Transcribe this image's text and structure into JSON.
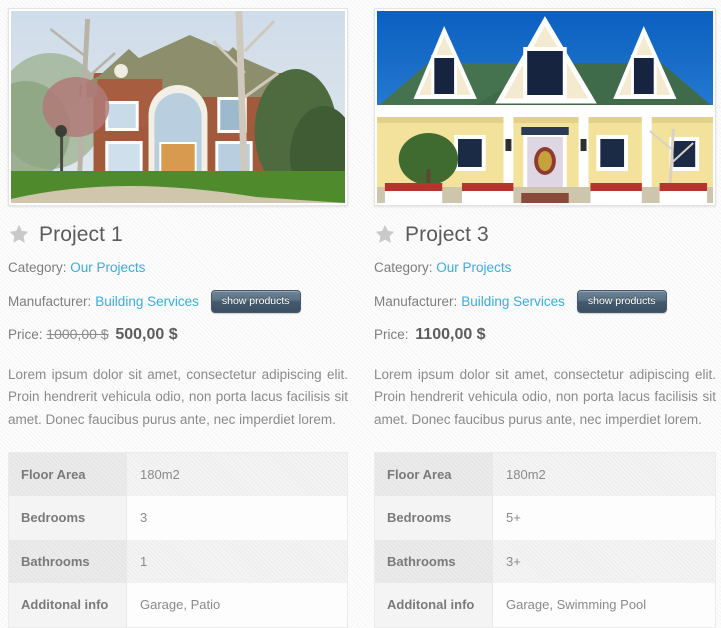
{
  "projects": [
    {
      "id": "project-1",
      "title": "Project 1",
      "favorite_icon": "star-icon",
      "photo": {
        "alt": "Brick colonial two-story house with arched entry, trees and lawn",
        "sky": "#c6d7e8",
        "roof": "#8e8f6c",
        "brick": "#a85c3e",
        "lawn": "#4f8b2c",
        "door": "#d79a4e"
      },
      "category_label": "Category:",
      "category_value": "Our Projects",
      "manufacturer_label": "Manufacturer:",
      "manufacturer_value": "Building Services",
      "show_products_label": "show products",
      "price_label": "Price:",
      "price_old": "1000,00 $",
      "price_new": "500,00 $",
      "description": "Lorem ipsum dolor sit amet, consectetur adipiscing elit. Proin hendrerit vehicula odio, non porta lacus facilisis sit amet. Donec faucibus purus ante, nec imperdiet lorem.",
      "specs": [
        {
          "label": "Floor Area",
          "value": "180m2"
        },
        {
          "label": "Bedrooms",
          "value": "3"
        },
        {
          "label": "Bathrooms",
          "value": "1"
        },
        {
          "label": "Additonal info",
          "value": "Garage, Patio"
        }
      ]
    },
    {
      "id": "project-3",
      "title": "Project 3",
      "favorite_icon": "star-icon",
      "photo": {
        "alt": "Yellow single-story house with green shingle roof and three dormer windows",
        "sky": "#1e6fc4",
        "roof": "#3f6b4a",
        "siding": "#f2e09a",
        "lawn": "#b8b090",
        "door": "#e6e0e8"
      },
      "category_label": "Category:",
      "category_value": "Our Projects",
      "manufacturer_label": "Manufacturer:",
      "manufacturer_value": "Building Services",
      "show_products_label": "show products",
      "price_label": "Price:",
      "price_old": "",
      "price_new": "1100,00 $",
      "description": "Lorem ipsum dolor sit amet, consectetur adipiscing elit. Proin hendrerit vehicula odio, non porta lacus facilisis sit amet. Donec faucibus purus ante, nec imperdiet lorem.",
      "specs": [
        {
          "label": "Floor Area",
          "value": "180m2"
        },
        {
          "label": "Bedrooms",
          "value": "5+"
        },
        {
          "label": "Bathrooms",
          "value": "3+"
        },
        {
          "label": "Additonal info",
          "value": "Garage, Swimming Pool"
        }
      ]
    }
  ],
  "theme": {
    "link_color": "#36aee0",
    "text_color": "#7d7d7d",
    "title_color": "#5b5b5b",
    "button_color": "#5b7386",
    "star_color": "#c9c9c9"
  }
}
